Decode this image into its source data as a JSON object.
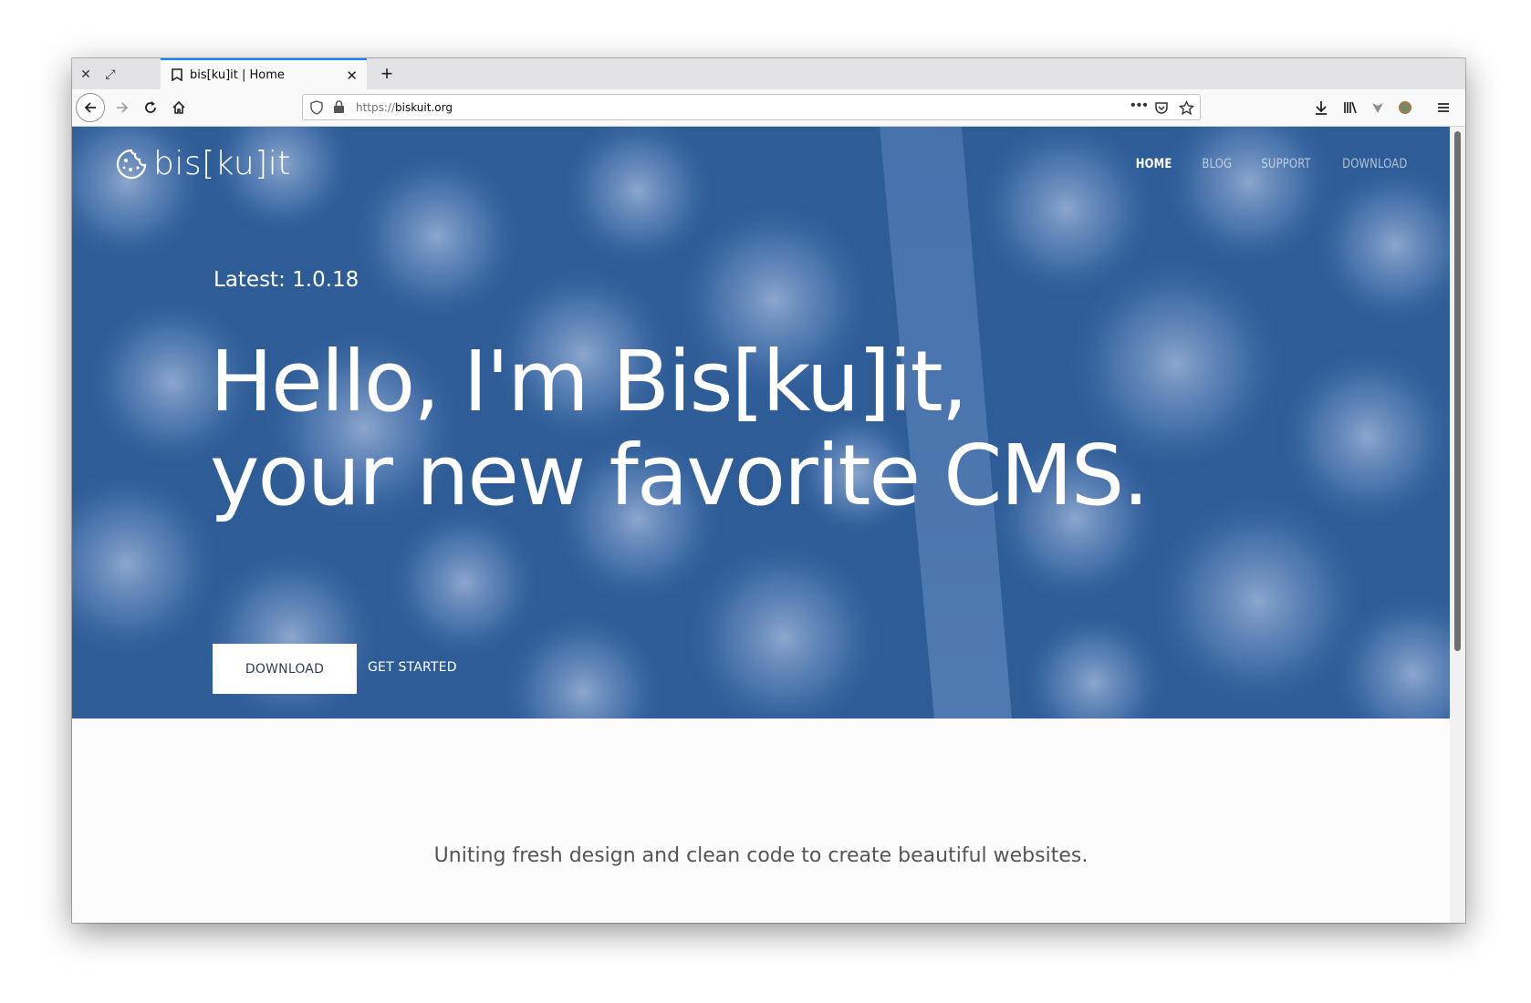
{
  "browser": {
    "tab_title": "bis[ku]it | Home",
    "url_scheme": "https://",
    "url_host": "biskuit.org",
    "icons": [
      "close-icon",
      "restore-icon",
      "new-tab-icon",
      "back-icon",
      "forward-icon",
      "reload-icon",
      "home-icon",
      "shield-icon",
      "lock-icon",
      "more-icon",
      "pocket-icon",
      "bookmark-star-icon",
      "download-icon",
      "library-icon",
      "extension-icon",
      "profile-icon",
      "menu-icon"
    ]
  },
  "site": {
    "logo_text": "bis[ku]it",
    "nav": [
      "HOME",
      "BLOG",
      "SUPPORT",
      "DOWNLOAD"
    ],
    "latest": "Latest: 1.0.18",
    "headline_line1": "Hello, I'm Bis[ku]it,",
    "headline_line2": "your new favorite CMS.",
    "download_label": "DOWNLOAD",
    "get_started_label": "GET STARTED",
    "tagline": "Uniting fresh design and clean code to create beautiful websites."
  },
  "colors": {
    "hero": "#2f5e98",
    "accent": "#0a84ff"
  }
}
